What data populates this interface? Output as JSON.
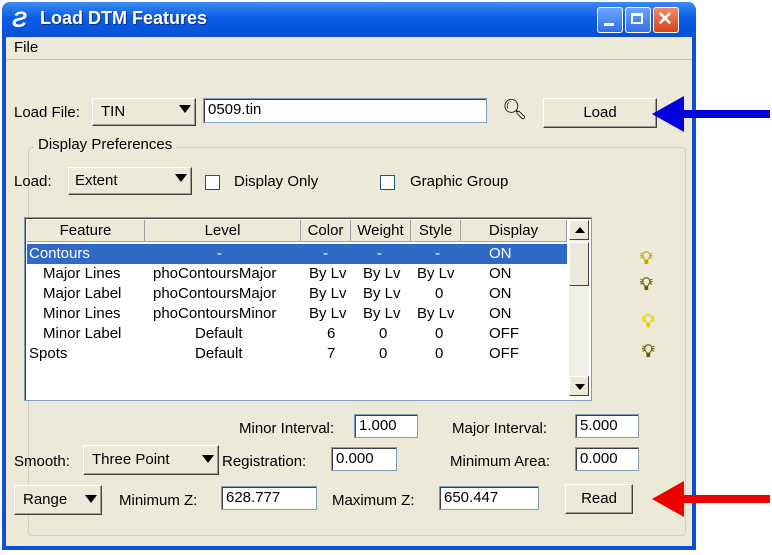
{
  "window": {
    "title": "Load DTM Features"
  },
  "menu": {
    "file": "File"
  },
  "load_file": {
    "label": "Load File:",
    "type_value": "TIN",
    "file_value": "0509.tin",
    "load_button": "Load"
  },
  "display_prefs": {
    "title": "Display Preferences",
    "load_label": "Load:",
    "load_value": "Extent",
    "display_only": "Display Only",
    "graphic_group": "Graphic Group"
  },
  "table": {
    "columns": [
      "Feature",
      "Level",
      "Color",
      "Weight",
      "Style",
      "Display"
    ],
    "rows": [
      [
        "Contours",
        "-",
        "-",
        "-",
        "-",
        "ON"
      ],
      [
        "Major Lines",
        "phoContoursMajor",
        "By Lv",
        "By Lv",
        "By Lv",
        "ON"
      ],
      [
        "Major Label",
        "phoContoursMajor",
        "By Lv",
        "By Lv",
        "0",
        "ON"
      ],
      [
        "Minor Lines",
        "phoContoursMinor",
        "By Lv",
        "By Lv",
        "By Lv",
        "ON"
      ],
      [
        "Minor Label",
        "Default",
        "6",
        "0",
        "0",
        "OFF"
      ],
      [
        "Spots",
        "Default",
        "7",
        "0",
        "0",
        "OFF"
      ]
    ]
  },
  "intervals": {
    "minor_label": "Minor Interval:",
    "minor_value": "1.000",
    "major_label": "Major Interval:",
    "major_value": "5.000"
  },
  "smooth": {
    "label": "Smooth:",
    "value": "Three Point",
    "registration_label": "Registration:",
    "registration_value": "0.000",
    "min_area_label": "Minimum Area:",
    "min_area_value": "0.000"
  },
  "range": {
    "value": "Range",
    "min_z_label": "Minimum Z:",
    "min_z_value": "628.777",
    "max_z_label": "Maximum Z:",
    "max_z_value": "650.447",
    "read_button": "Read"
  },
  "colors": {
    "blue_arrow": "#0000dd",
    "red_arrow": "#ee0000",
    "selection": "#316ac5"
  }
}
